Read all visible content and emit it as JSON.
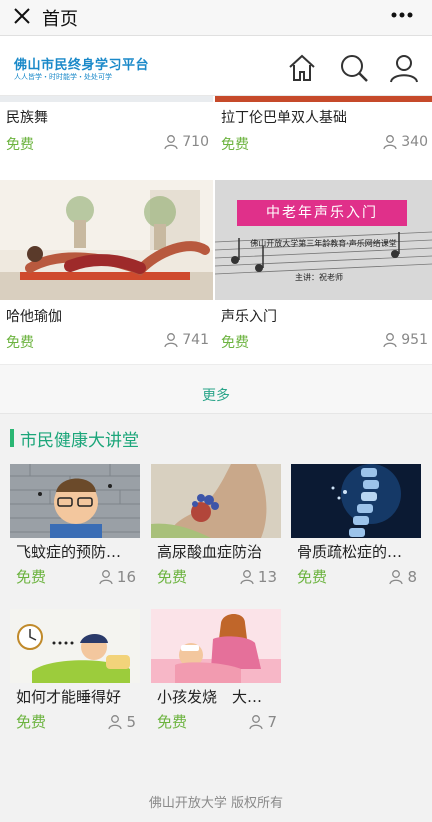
{
  "topbar": {
    "title": "首页"
  },
  "site": {
    "name": "佛山市民终身学习平台",
    "slogan": "人人皆学・时时能学・处处可学"
  },
  "header_icons": [
    "home-icon",
    "search-icon",
    "user-icon"
  ],
  "courses": [
    {
      "title": "民族舞",
      "price": "免费",
      "count": "710"
    },
    {
      "title": "拉丁伦巴单双人基础",
      "price": "免费",
      "count": "340"
    },
    {
      "title": "哈他瑜伽",
      "price": "免费",
      "count": "741"
    },
    {
      "title": "声乐入门",
      "price": "免费",
      "count": "951",
      "thumb_title": "中老年声乐入门",
      "thumb_subtitle": "佛山开放大学第三年龄教育·声乐网络课堂",
      "thumb_teacher": "主讲：祝老师"
    }
  ],
  "more_label": "更多",
  "health": {
    "section_title": "市民健康大讲堂",
    "items": [
      {
        "title": "飞蚊症的预防…",
        "price": "免费",
        "count": "16"
      },
      {
        "title": "高尿酸血症防治",
        "price": "免费",
        "count": "13"
      },
      {
        "title": "骨质疏松症的…",
        "price": "免费",
        "count": "8"
      },
      {
        "title": "如何才能睡得好",
        "price": "免费",
        "count": "5"
      },
      {
        "title": "小孩发烧　大…",
        "price": "免费",
        "count": "7"
      }
    ]
  },
  "footer": "佛山开放大学 版权所有",
  "colors": {
    "accent": "#1ca67a",
    "free": "#6cb33f",
    "brand": "#1a89c9"
  }
}
